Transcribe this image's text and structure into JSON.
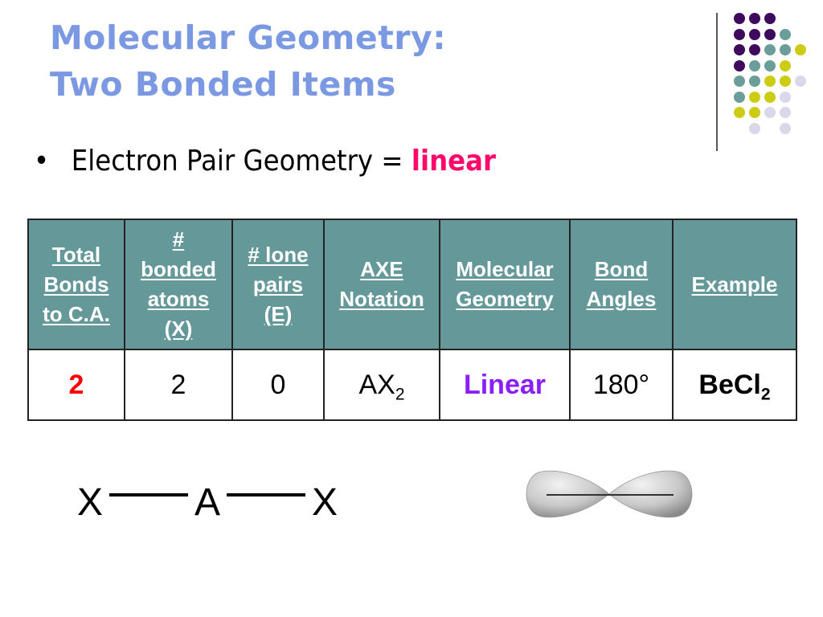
{
  "slide": {
    "title_line1": "Molecular Geometry:",
    "title_line2": "Two Bonded Items",
    "bullet": {
      "symbol": "•",
      "text": "Electron Pair Geometry = ",
      "accent": "linear",
      "accent_color": "#ff0a6a"
    },
    "decor": {
      "dot_colors": {
        "purple": "#3d0a5e",
        "teal": "#6b9e9a",
        "yellow": "#cccc14",
        "lavender": "#d8d8ea"
      }
    }
  },
  "table": {
    "header_bg": "#659999",
    "headers": [
      [
        "Total",
        "Bonds",
        "to C.A."
      ],
      [
        "#",
        "bonded",
        "atoms",
        "(X)"
      ],
      [
        "# lone",
        "pairs",
        "(E)"
      ],
      [
        "AXE",
        "Notation"
      ],
      [
        "Molecular",
        "Geometry"
      ],
      [
        "Bond",
        "Angles"
      ],
      [
        "Example"
      ]
    ],
    "row": {
      "total_bonds": "2",
      "bonded_atoms": "2",
      "lone_pairs": "0",
      "axe_base": "AX",
      "axe_sub": "2",
      "geometry": "Linear",
      "angle": "180°",
      "example_base": "BeCl",
      "example_sub": "2"
    }
  },
  "diagram": {
    "left_atom": "X",
    "center_atom": "A",
    "right_atom": "X"
  }
}
